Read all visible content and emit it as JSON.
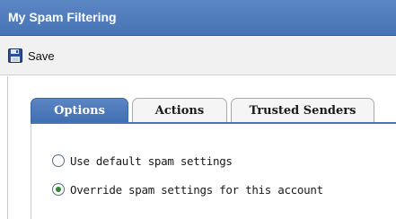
{
  "window": {
    "title": "My Spam Filtering"
  },
  "toolbar": {
    "save_label": "Save",
    "save_icon": "floppy-disk-icon"
  },
  "tabs": [
    {
      "label": "Options",
      "active": true
    },
    {
      "label": "Actions",
      "active": false
    },
    {
      "label": "Trusted Senders",
      "active": false
    }
  ],
  "options": {
    "default_label": "Use default spam settings",
    "override_label": "Override spam settings for this account",
    "selected": "override"
  },
  "colors": {
    "accent": "#4774b6",
    "radio_check": "#2c8a2c"
  }
}
